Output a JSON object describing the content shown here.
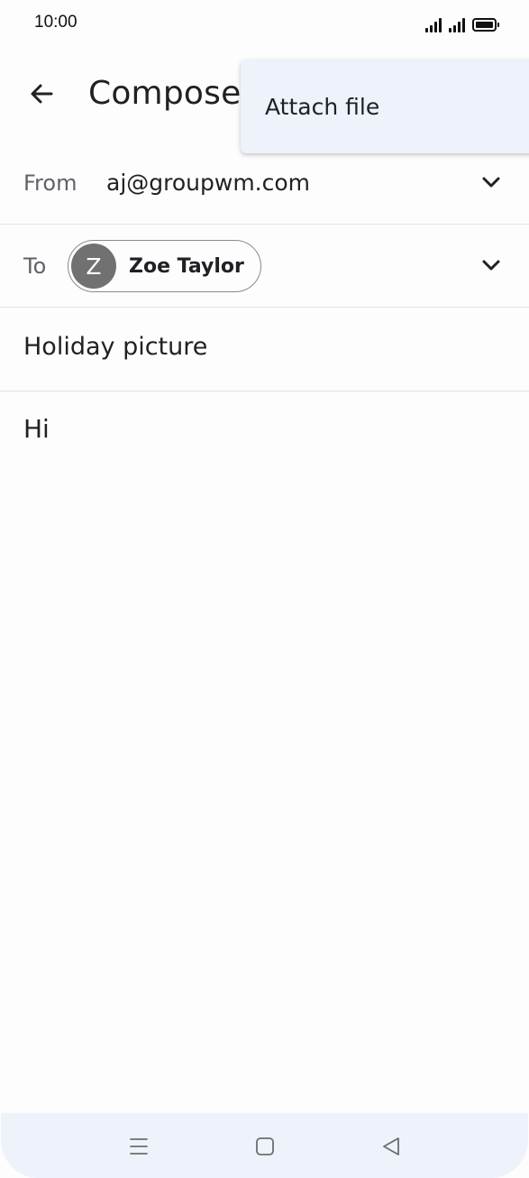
{
  "status_bar": {
    "time": "10:00"
  },
  "header": {
    "title": "Compose",
    "back_icon": "arrow-left-icon"
  },
  "overflow_menu": {
    "items": [
      {
        "label": "Attach file"
      }
    ]
  },
  "compose": {
    "from_label": "From",
    "from_value": "aj@groupwm.com",
    "to_label": "To",
    "recipient": {
      "initial": "Z",
      "name": "Zoe Taylor"
    },
    "subject": "Holiday picture",
    "body": "Hi"
  },
  "nav_bar": {
    "icons": [
      "menu-icon",
      "home-icon",
      "back-triangle-icon"
    ]
  },
  "colors": {
    "menu_background": "#eef2fa",
    "avatar_background": "#717171",
    "nav_background": "#eef2fa",
    "divider": "#e3e3e3"
  }
}
